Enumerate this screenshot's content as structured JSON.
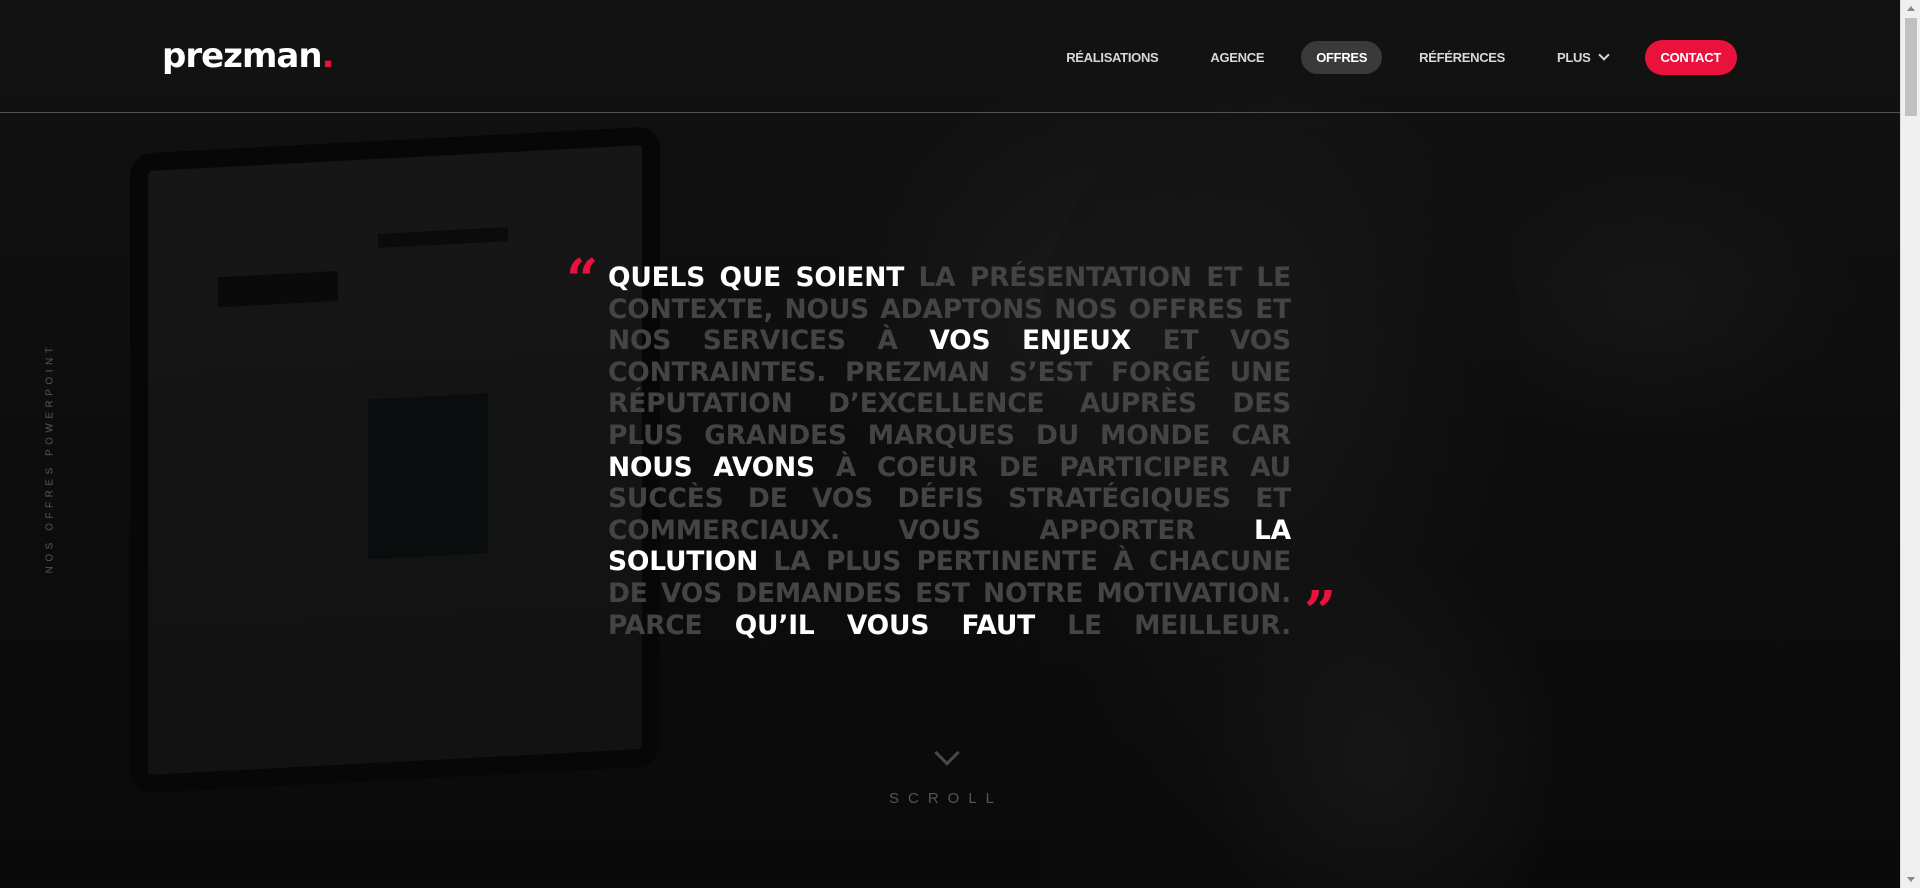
{
  "brand": {
    "name": "prezman",
    "dot": ".",
    "accent_color": "#e8123c"
  },
  "nav": {
    "items": [
      {
        "label": "Réalisations"
      },
      {
        "label": "Agence"
      },
      {
        "label": "Offres",
        "active": true
      },
      {
        "label": "Références"
      },
      {
        "label": "Plus",
        "has_dropdown": true
      }
    ],
    "contact_label": "Contact"
  },
  "side_label": "Nos offres PowerPoint",
  "quote": {
    "open_mark": "“",
    "close_mark": "”",
    "segments": [
      {
        "text": "Quels que soient ",
        "highlight": true
      },
      {
        "text": "la présentation et le contexte, nous adaptons nos offres et nos services à ",
        "highlight": false
      },
      {
        "text": "vos enjeux",
        "highlight": true
      },
      {
        "text": " et vos contraintes. Prezman s’est forgé une réputation d’excellence auprès des plus grandes marques du monde car ",
        "highlight": false
      },
      {
        "text": "nous avons",
        "highlight": true
      },
      {
        "text": " à coeur de participer au succès de vos défis stratégiques et commerciaux. Vous apporter ",
        "highlight": false
      },
      {
        "text": "la solution",
        "highlight": true
      },
      {
        "text": " la plus pertinente à chacune de vos demandes est notre motivation. Parce ",
        "highlight": false
      },
      {
        "text": "qu’il vous faut",
        "highlight": true
      },
      {
        "text": " le meilleur.",
        "highlight": false
      }
    ]
  },
  "scroll": {
    "label": "Scroll",
    "icon": "chevron-down-icon"
  }
}
